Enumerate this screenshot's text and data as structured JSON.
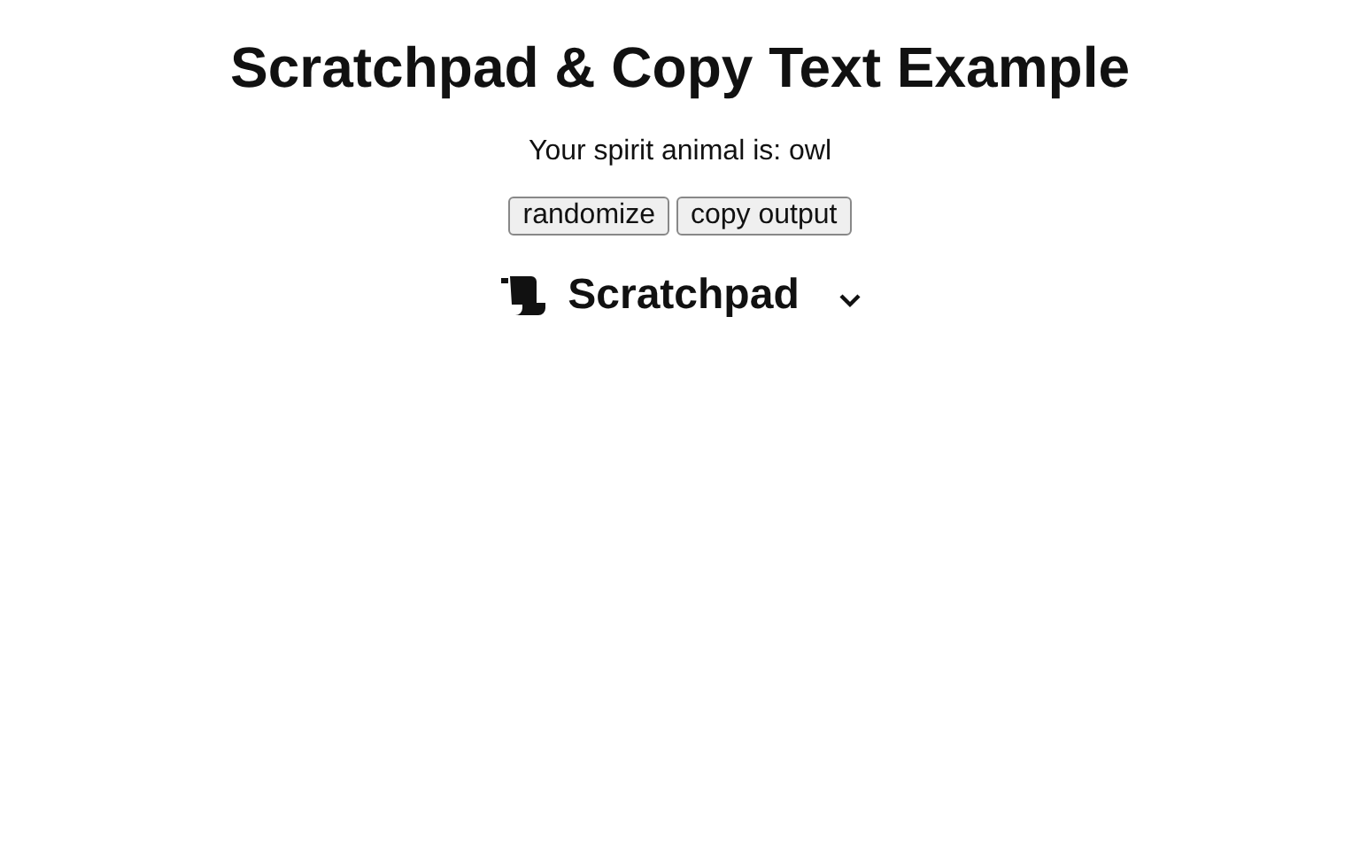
{
  "title": "Scratchpad & Copy Text Example",
  "result": "Your spirit animal is: owl",
  "buttons": [
    "randomize",
    "copy output"
  ],
  "scratchpad": {
    "label": "Scratchpad",
    "expanded": false
  }
}
